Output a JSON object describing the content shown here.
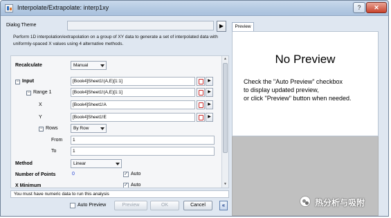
{
  "window": {
    "title": "Interpolate/Extrapolate: interp1xy",
    "help_label": "?",
    "close_label": "✕"
  },
  "dialog_theme": {
    "label": "Dialog Theme",
    "value": "",
    "arrow": "▶"
  },
  "description": "Perform 1D interpolation/extrapolation on a group of XY data to generate a set of interpolated data with uniformly-spaced X values using 4 alternative methods.",
  "form": {
    "recalculate": {
      "label": "Recalculate",
      "value": "Manual"
    },
    "input": {
      "label": "Input",
      "toggle": "−",
      "value": "[Book4]Sheet1!(A,E)[1:1]",
      "range": {
        "label": "Range 1",
        "toggle": "−",
        "value": "[Book4]Sheet1!(A,E)[1:1]",
        "x": {
          "label": "X",
          "value": "[Book4]Sheet1!A"
        },
        "y": {
          "label": "Y",
          "value": "[Book4]Sheet1!E"
        },
        "rows": {
          "label": "Rows",
          "toggle": "−",
          "value": "By Row",
          "from": {
            "label": "From",
            "value": "1"
          },
          "to": {
            "label": "To",
            "value": "1"
          }
        }
      }
    },
    "method": {
      "label": "Method",
      "value": "Linear"
    },
    "number_of_points": {
      "label": "Number of Points",
      "value": "0",
      "auto_label": "Auto",
      "auto_checked": true
    },
    "x_minimum": {
      "label": "X Minimum",
      "auto_label": "Auto",
      "auto_checked": true
    }
  },
  "status_message": "You must have numeric data to run this analysis",
  "buttons": {
    "auto_preview": "Auto Preview",
    "preview": "Preview",
    "ok": "OK",
    "cancel": "Cancel",
    "collapse": "«"
  },
  "preview": {
    "tab_label": "Preview",
    "heading": "No Preview",
    "message_lines": [
      "Check the \"Auto Preview\" checkbox",
      "to display updated preview,",
      "or click \"Preview\" button when needed."
    ]
  },
  "watermark": {
    "text": "热分析与吸附"
  }
}
